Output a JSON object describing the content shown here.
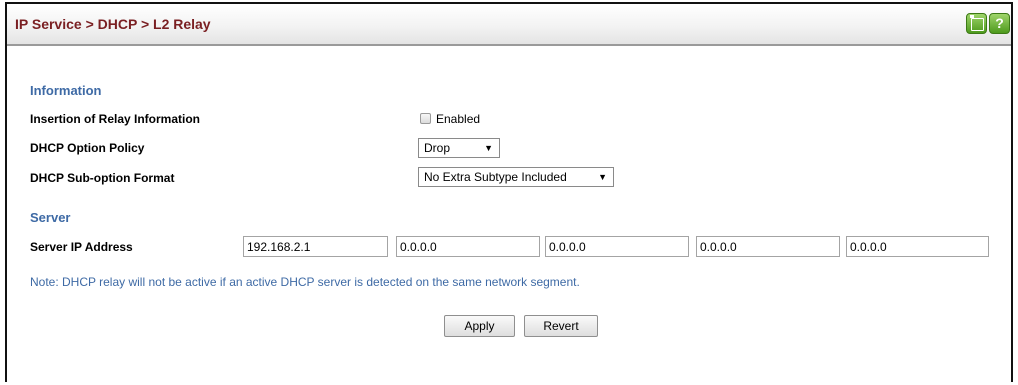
{
  "title": "IP Service > DHCP > L2 Relay",
  "icons": {
    "save": "save-icon",
    "help_label": "?"
  },
  "information": {
    "heading": "Information",
    "insertion_label": "Insertion of Relay Information",
    "insertion_checkbox_label": "Enabled",
    "insertion_checked": false,
    "policy_label": "DHCP Option Policy",
    "policy_value": "Drop",
    "format_label": "DHCP Sub-option Format",
    "format_value": "No Extra Subtype Included"
  },
  "server": {
    "heading": "Server",
    "ip_label": "Server IP Address",
    "ip_values": [
      "192.168.2.1",
      "0.0.0.0",
      "0.0.0.0",
      "0.0.0.0",
      "0.0.0.0"
    ]
  },
  "note": "Note: DHCP relay will not be active if an active DHCP server is detected on the same network segment.",
  "buttons": {
    "apply": "Apply",
    "revert": "Revert"
  },
  "colors": {
    "title": "#7a1f22",
    "section": "#3e6aa5",
    "icon_green": "#5aa82a"
  }
}
